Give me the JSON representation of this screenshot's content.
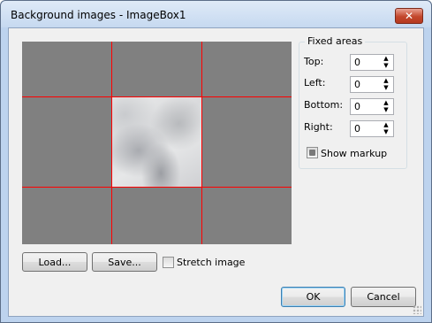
{
  "window": {
    "title": "Background images - ImageBox1",
    "close_symbol": "✕"
  },
  "fixed_areas": {
    "group_title": "Fixed areas",
    "fields": [
      {
        "label": "Top:",
        "value": "0"
      },
      {
        "label": "Left:",
        "value": "0"
      },
      {
        "label": "Bottom:",
        "value": "0"
      },
      {
        "label": "Right:",
        "value": "0"
      }
    ],
    "show_markup": {
      "label": "Show markup",
      "checked": "indeterminate"
    }
  },
  "buttons": {
    "load": "Load...",
    "save": "Save...",
    "ok": "OK",
    "cancel": "Cancel"
  },
  "stretch_image": {
    "label": "Stretch image",
    "checked": false
  },
  "icons": {
    "spin_up": "▲",
    "spin_down": "▼"
  },
  "colors": {
    "preview_background": "#808080",
    "markup_lines": "#ff0000"
  }
}
